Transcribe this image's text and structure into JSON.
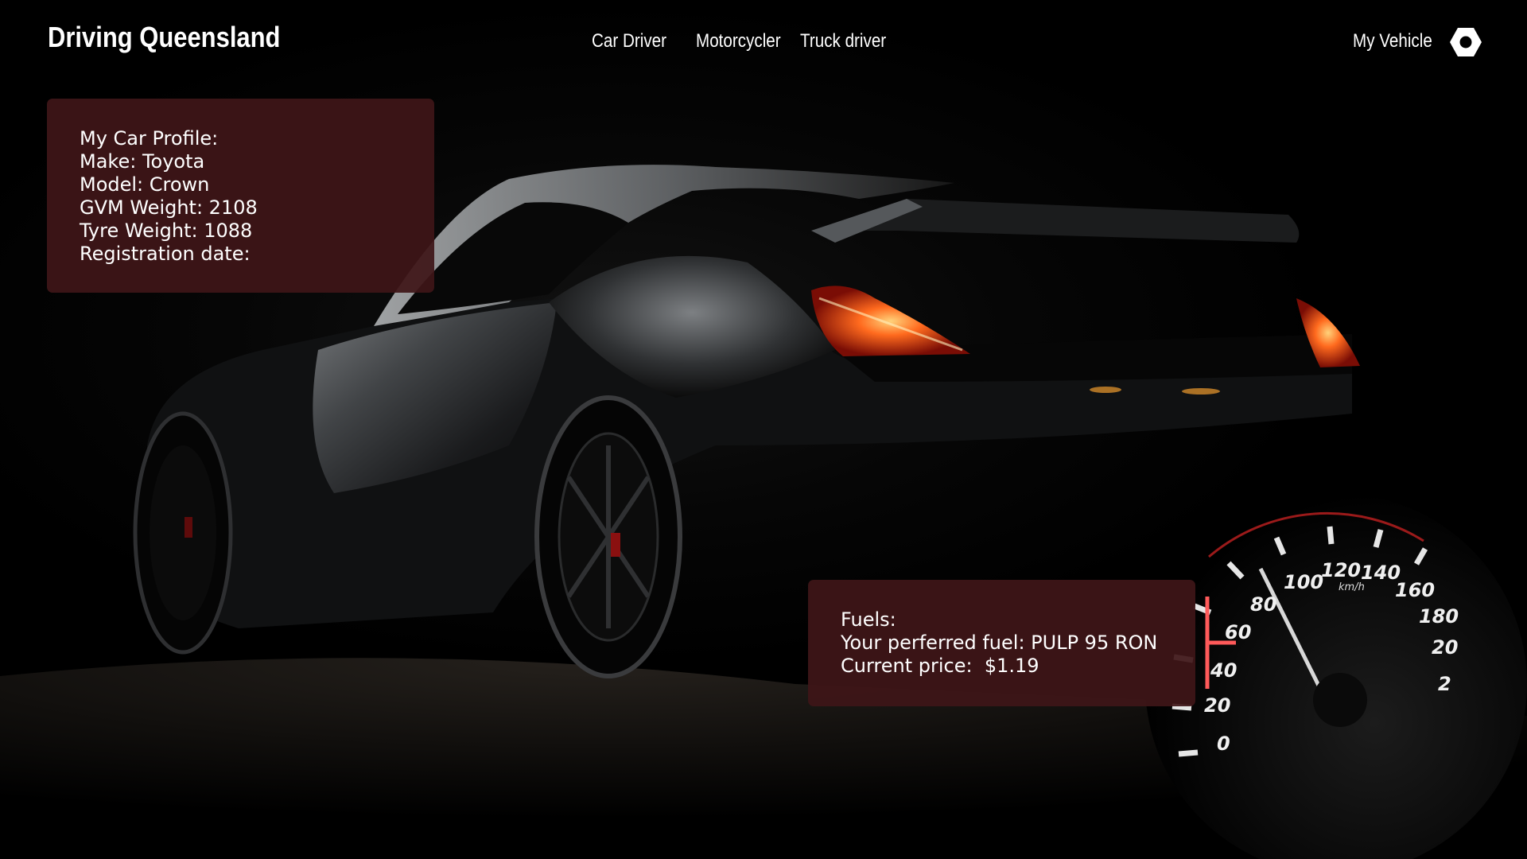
{
  "header": {
    "brand": "Driving Queensland",
    "nav": {
      "car_driver": "Car Driver",
      "motorcycler": "Motorcycler",
      "truck_driver": "Truck driver",
      "my_vehicle": "My Vehicle"
    },
    "settings_icon": "gear-icon"
  },
  "profile_card": {
    "title": "My Car Profile:",
    "make": "Make: Toyota",
    "model": "Model: Crown",
    "gvm_weight": "GVM Weight: 2108",
    "tyre_weight": "Tyre Weight: 1088",
    "registration_date": "Registration date:"
  },
  "fuel_card": {
    "title": "Fuels:",
    "preferred_fuel": "Your perferred fuel: PULP 95 RON",
    "current_price": "Current price:  $1.19"
  },
  "speedometer": {
    "unit": "km/h",
    "ticks": [
      "0",
      "20",
      "40",
      "60",
      "80",
      "100",
      "120",
      "140",
      "160",
      "180",
      "20",
      "2"
    ]
  },
  "colors": {
    "card_background": "#3e1618",
    "taillight": "#ff5a1a",
    "gauge_redline": "#ff4a4a"
  }
}
